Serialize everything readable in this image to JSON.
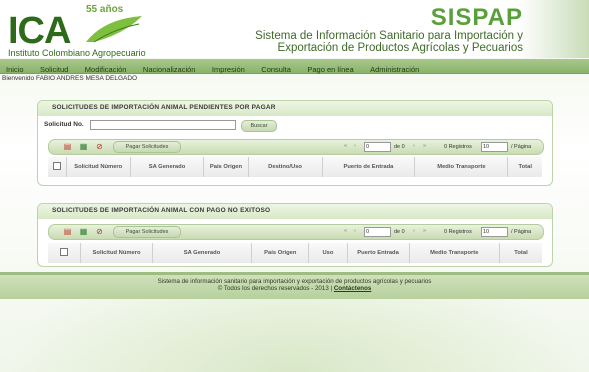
{
  "header": {
    "logo_text": "ICA",
    "logo_badge": "55 años",
    "logo_org": "Instituto Colombiano Agropecuario",
    "app_name": "SISPAP",
    "app_subtitle_line1": "Sistema de Información Sanitario para Importación y",
    "app_subtitle_line2": "Exportación de Productos Agrícolas y Pecuarios"
  },
  "menu": [
    "Inicio",
    "Solicitud",
    "Modificación",
    "Nacionalización",
    "Impresión",
    "Consulta",
    "Pago en línea",
    "Administración"
  ],
  "welcome": "Bienvenido FABIO ANDRES MESA DELGADO",
  "panel1": {
    "title": "SOLICITUDES DE IMPORTACIÓN ANIMAL PENDIENTES POR PAGAR",
    "search_label": "Solicitud No.",
    "search_value": "",
    "search_button": "Buscar",
    "pay_button": "Pagar Solicitudes",
    "page_value": "0",
    "page_of": "de 0",
    "registros": "0 Registros",
    "page_size": "10",
    "per_page": "/ Página",
    "columns": [
      "Solicitud Número",
      "SA Generado",
      "País Origen",
      "Destino/Uso",
      "Puerto de Entrada",
      "Medio Transporte",
      "Total"
    ]
  },
  "panel2": {
    "title": "SOLICITUDES DE IMPORTACIÓN ANIMAL CON PAGO NO EXITOSO",
    "pay_button": "Pagar Solicitudes",
    "page_value": "0",
    "page_of": "de 0",
    "registros": "0 Registros",
    "page_size": "10",
    "per_page": "/ Página",
    "columns": [
      "Solicitud Número",
      "SA Generado",
      "País Origen",
      "Uso",
      "Puerto Entrada",
      "Medio Transporte",
      "Total"
    ]
  },
  "footer": {
    "line1": "Sistema de información sanitario para importación y exportación de productos agrícolas y pecuarios",
    "line2": "© Todos los derechos reservados - 2013 |",
    "contact": "Contáctenos"
  }
}
